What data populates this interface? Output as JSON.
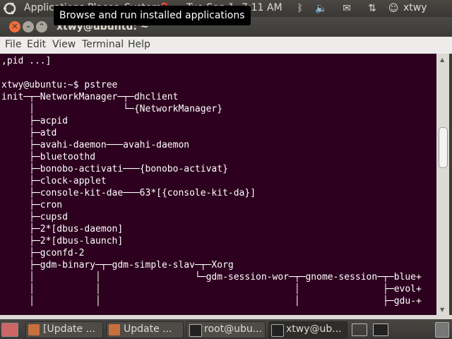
{
  "top_panel": {
    "applications": "Applications",
    "places": "Places",
    "system": "System",
    "date": "Tue Sep 1",
    "clock": "7:11 AM",
    "user": "xtwy",
    "tooltip": "Browse and run installed applications"
  },
  "window": {
    "title": "xtwy@ubuntu: ~",
    "menu": [
      "File",
      "Edit",
      "View",
      "Terminal",
      "Help"
    ]
  },
  "terminal": {
    "lines": [
      ",pid ...]",
      "",
      "xtwy@ubuntu:~$ pstree",
      "init─┬─NetworkManager─┬─dhclient",
      "     │                └─{NetworkManager}",
      "     ├─acpid",
      "     ├─atd",
      "     ├─avahi-daemon───avahi-daemon",
      "     ├─bluetoothd",
      "     ├─bonobo-activati───{bonobo-activat}",
      "     ├─clock-applet",
      "     ├─console-kit-dae───63*[{console-kit-da}]",
      "     ├─cron",
      "     ├─cupsd",
      "     ├─2*[dbus-daemon]",
      "     ├─2*[dbus-launch]",
      "     ├─gconfd-2",
      "     ├─gdm-binary─┬─gdm-simple-slav─┬─Xorg",
      "     │           │                 └─gdm-session-wor─┬─gnome-session─┬─blue+",
      "     │           │                                   │               ├─evol+",
      "     │           │                                   │               ├─gdu-+"
    ]
  },
  "taskbar": {
    "tasks": [
      "[Update ...",
      "Update ...",
      "root@ubu...",
      "xtwy@ub..."
    ]
  },
  "colors": {
    "terminal_bg": "#2c001e",
    "panel_bg": "#3c3b37",
    "close_button": "#f26d3d"
  }
}
